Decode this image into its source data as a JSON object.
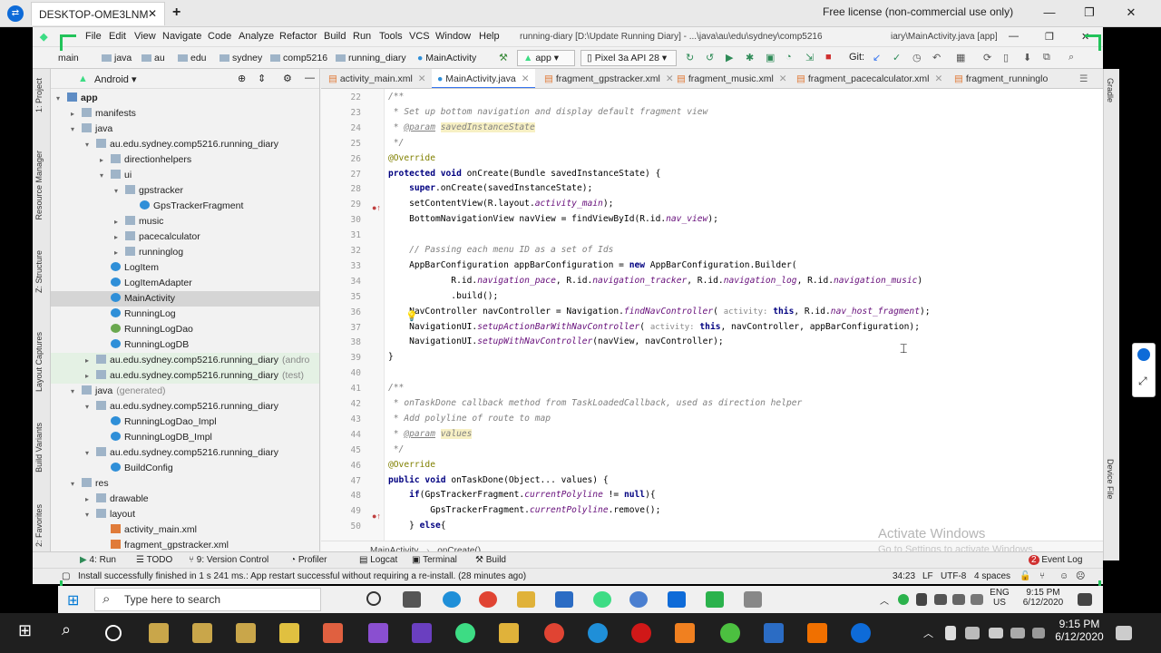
{
  "teamviewer": {
    "tab_title": "DESKTOP-OME3LNM",
    "license": "Free license (non-commercial use only)"
  },
  "menu": {
    "items": [
      "File",
      "Edit",
      "View",
      "Navigate",
      "Code",
      "Analyze",
      "Refactor",
      "Build",
      "Run",
      "Tools",
      "VCS",
      "Window",
      "Help"
    ],
    "title": "running-diary [D:\\Update Running Diary] - ...\\java\\au\\edu\\sydney\\comp5216",
    "title2": "iary\\MainActivity.java [app]"
  },
  "nav": {
    "crumbs": [
      "main",
      "java",
      "au",
      "edu",
      "sydney",
      "comp5216",
      "running_diary",
      "MainActivity"
    ],
    "run_config": "app",
    "device": "Pixel 3a API 28",
    "git_label": "Git:"
  },
  "left_strip": [
    "1: Project",
    "Resource Manager",
    "Z: Structure",
    "Layout Captures",
    "Build Variants",
    "2: Favorites"
  ],
  "right_strip": [
    "Gradle",
    "Device File"
  ],
  "project": {
    "view": "Android",
    "tree": [
      {
        "t": "app",
        "d": 0,
        "i": "fdb",
        "a": "▾",
        "b": true
      },
      {
        "t": "manifests",
        "d": 1,
        "i": "fd",
        "a": "▸"
      },
      {
        "t": "java",
        "d": 1,
        "i": "fd",
        "a": "▾"
      },
      {
        "t": "au.edu.sydney.comp5216.running_diary",
        "d": 2,
        "i": "fd",
        "a": "▾"
      },
      {
        "t": "directionhelpers",
        "d": 3,
        "i": "fd",
        "a": "▸"
      },
      {
        "t": "ui",
        "d": 3,
        "i": "fd",
        "a": "▾"
      },
      {
        "t": "gpstracker",
        "d": 4,
        "i": "fd",
        "a": "▾"
      },
      {
        "t": "GpsTrackerFragment",
        "d": 5,
        "i": "cl",
        "a": ""
      },
      {
        "t": "music",
        "d": 4,
        "i": "fd",
        "a": "▸"
      },
      {
        "t": "pacecalculator",
        "d": 4,
        "i": "fd",
        "a": "▸"
      },
      {
        "t": "runninglog",
        "d": 4,
        "i": "fd",
        "a": "▸"
      },
      {
        "t": "LogItem",
        "d": 3,
        "i": "cl",
        "a": ""
      },
      {
        "t": "LogItemAdapter",
        "d": 3,
        "i": "cl",
        "a": ""
      },
      {
        "t": "MainActivity",
        "d": 3,
        "i": "cl",
        "a": "",
        "sel": true
      },
      {
        "t": "RunningLog",
        "d": 3,
        "i": "cl",
        "a": ""
      },
      {
        "t": "RunningLogDao",
        "d": 3,
        "i": "gr",
        "a": ""
      },
      {
        "t": "RunningLogDB",
        "d": 3,
        "i": "cl",
        "a": ""
      },
      {
        "t": "au.edu.sydney.comp5216.running_diary",
        "d": 2,
        "i": "fd",
        "a": "▸",
        "suffix": "(andro",
        "green": true
      },
      {
        "t": "au.edu.sydney.comp5216.running_diary",
        "d": 2,
        "i": "fd",
        "a": "▸",
        "suffix": "(test)",
        "green": true
      },
      {
        "t": "java",
        "d": 1,
        "i": "fd",
        "a": "▾",
        "suffix": "(generated)"
      },
      {
        "t": "au.edu.sydney.comp5216.running_diary",
        "d": 2,
        "i": "fd",
        "a": "▾"
      },
      {
        "t": "RunningLogDao_Impl",
        "d": 3,
        "i": "cl",
        "a": ""
      },
      {
        "t": "RunningLogDB_Impl",
        "d": 3,
        "i": "cl",
        "a": ""
      },
      {
        "t": "au.edu.sydney.comp5216.running_diary",
        "d": 2,
        "i": "fd",
        "a": "▾"
      },
      {
        "t": "BuildConfig",
        "d": 3,
        "i": "cl",
        "a": ""
      },
      {
        "t": "res",
        "d": 1,
        "i": "fd",
        "a": "▾"
      },
      {
        "t": "drawable",
        "d": 2,
        "i": "fd",
        "a": "▸"
      },
      {
        "t": "layout",
        "d": 2,
        "i": "fd",
        "a": "▾"
      },
      {
        "t": "activity_main.xml",
        "d": 3,
        "i": "xm",
        "a": ""
      },
      {
        "t": "fragment_gpstracker.xml",
        "d": 3,
        "i": "xm",
        "a": ""
      }
    ]
  },
  "tabs": [
    "activity_main.xml",
    "MainActivity.java",
    "fragment_gpstracker.xml",
    "fragment_music.xml",
    "fragment_pacecalculator.xml",
    "fragment_runninglo"
  ],
  "code": {
    "lines": [
      {
        "n": "22",
        "h": "<span class='cm'>/**</span>"
      },
      {
        "n": "23",
        "h": "<span class='cm'> * Set up bottom navigation and display default fragment view</span>"
      },
      {
        "n": "24",
        "h": "<span class='cm'> * <span class='dtag'>@param</span> </span><span class='hl'><span class='cm'>savedInstanceState</span></span>"
      },
      {
        "n": "25",
        "h": "<span class='cm'> */</span>"
      },
      {
        "n": "26",
        "h": "<span class='an'>@Override</span>"
      },
      {
        "n": "27",
        "h": "<span class='kw'>protected void</span> onCreate(Bundle savedInstanceState) {"
      },
      {
        "n": "28",
        "h": "    <span class='kw'>super</span>.onCreate(savedInstanceState);"
      },
      {
        "n": "29",
        "h": "    setContentView(R.layout.<span class='fld'>activity_main</span>);"
      },
      {
        "n": "30",
        "h": "    BottomNavigationView navView = findViewById(R.id.<span class='fld'>nav_view</span>);"
      },
      {
        "n": "31",
        "h": ""
      },
      {
        "n": "32",
        "h": "    <span class='cm'>// Passing each menu ID as a set of Ids</span>"
      },
      {
        "n": "33",
        "h": "    AppBarConfiguration appBarConfiguration = <span class='kw'>new</span> AppBarConfiguration.Builder("
      },
      {
        "n": "34",
        "h": "            R.id.<span class='fld'>navigation_pace</span>, R.id.<span class='fld'>navigation_tracker</span>, R.id.<span class='fld'>navigation_log</span>, R.id.<span class='fld'>navigation_music</span>)"
      },
      {
        "n": "35",
        "h": "            .build();"
      },
      {
        "n": "36",
        "h": "    NavController navController = Navigation.<span class='fld'>findNavController</span>( <span class='hint'>activity:</span> <span class='kw'>this</span>, R.id.<span class='fld'>nav_host_fragment</span>);"
      },
      {
        "n": "37",
        "h": "    NavigationUI.<span class='fld'>setupActionBarWithNavController</span>( <span class='hint'>activity:</span> <span class='kw'>this</span>, navController, appBarConfiguration);"
      },
      {
        "n": "38",
        "h": "    NavigationUI.<span class='fld'>setupWithNavController</span>(navView, navController);"
      },
      {
        "n": "39",
        "h": "}"
      },
      {
        "n": "40",
        "h": ""
      },
      {
        "n": "41",
        "h": "<span class='cm'>/**</span>"
      },
      {
        "n": "42",
        "h": "<span class='cm'> * onTaskDone callback method from TaskLoadedCallback, used as direction helper</span>"
      },
      {
        "n": "43",
        "h": "<span class='cm'> * Add polyline of route to map</span>"
      },
      {
        "n": "44",
        "h": "<span class='cm'> * <span class='dtag'>@param</span> </span><span class='hl'><span class='cm'>values</span></span>"
      },
      {
        "n": "45",
        "h": "<span class='cm'> */</span>"
      },
      {
        "n": "46",
        "h": "<span class='an'>@Override</span>"
      },
      {
        "n": "47",
        "h": "<span class='kw'>public void</span> onTaskDone(Object... values) {"
      },
      {
        "n": "48",
        "h": "    <span class='kw'>if</span>(GpsTrackerFragment.<span class='fld'>currentPolyline</span> != <span class='kw'>null</span>){"
      },
      {
        "n": "49",
        "h": "        GpsTrackerFragment.<span class='fld'>currentPolyline</span>.remove();"
      },
      {
        "n": "50",
        "h": "    } <span class='kw'>else</span>{"
      }
    ]
  },
  "breadcrumb_code": [
    "MainActivity",
    "onCreate()"
  ],
  "tool_windows": [
    "4: Run",
    "TODO",
    "9: Version Control",
    "Profiler",
    "Logcat",
    "Terminal",
    "Build"
  ],
  "event_log": "Event Log",
  "status": {
    "message": "Install successfully finished in 1 s 241 ms.: App restart successful without requiring a re-install. (28 minutes ago)",
    "position": "34:23",
    "line_sep": "LF",
    "encoding": "UTF-8",
    "indent": "4 spaces"
  },
  "activate": {
    "line1": "Activate Windows",
    "line2": "Go to Settings to activate Windows."
  },
  "remote_taskbar": {
    "search_placeholder": "Type here to search",
    "lang1": "ENG",
    "lang2": "US",
    "time": "9:15 PM",
    "date": "6/12/2020"
  },
  "host_taskbar": {
    "time": "9:15 PM",
    "date": "6/12/2020"
  }
}
